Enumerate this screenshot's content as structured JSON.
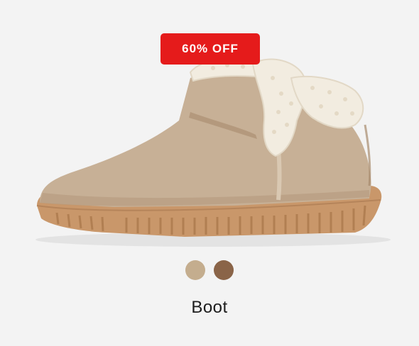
{
  "product": {
    "badge": "60% OFF",
    "name": "Boot",
    "image_icon": "boot-image",
    "swatches": [
      {
        "name": "tan",
        "color": "#c4ad8e"
      },
      {
        "name": "brown",
        "color": "#8a6448"
      }
    ]
  },
  "colors": {
    "badge_bg": "#e51b1b",
    "badge_text": "#ffffff",
    "background": "#f3f3f3",
    "suede": "#c7b096",
    "sole": "#c9976a",
    "shearling": "#f2ece0"
  }
}
